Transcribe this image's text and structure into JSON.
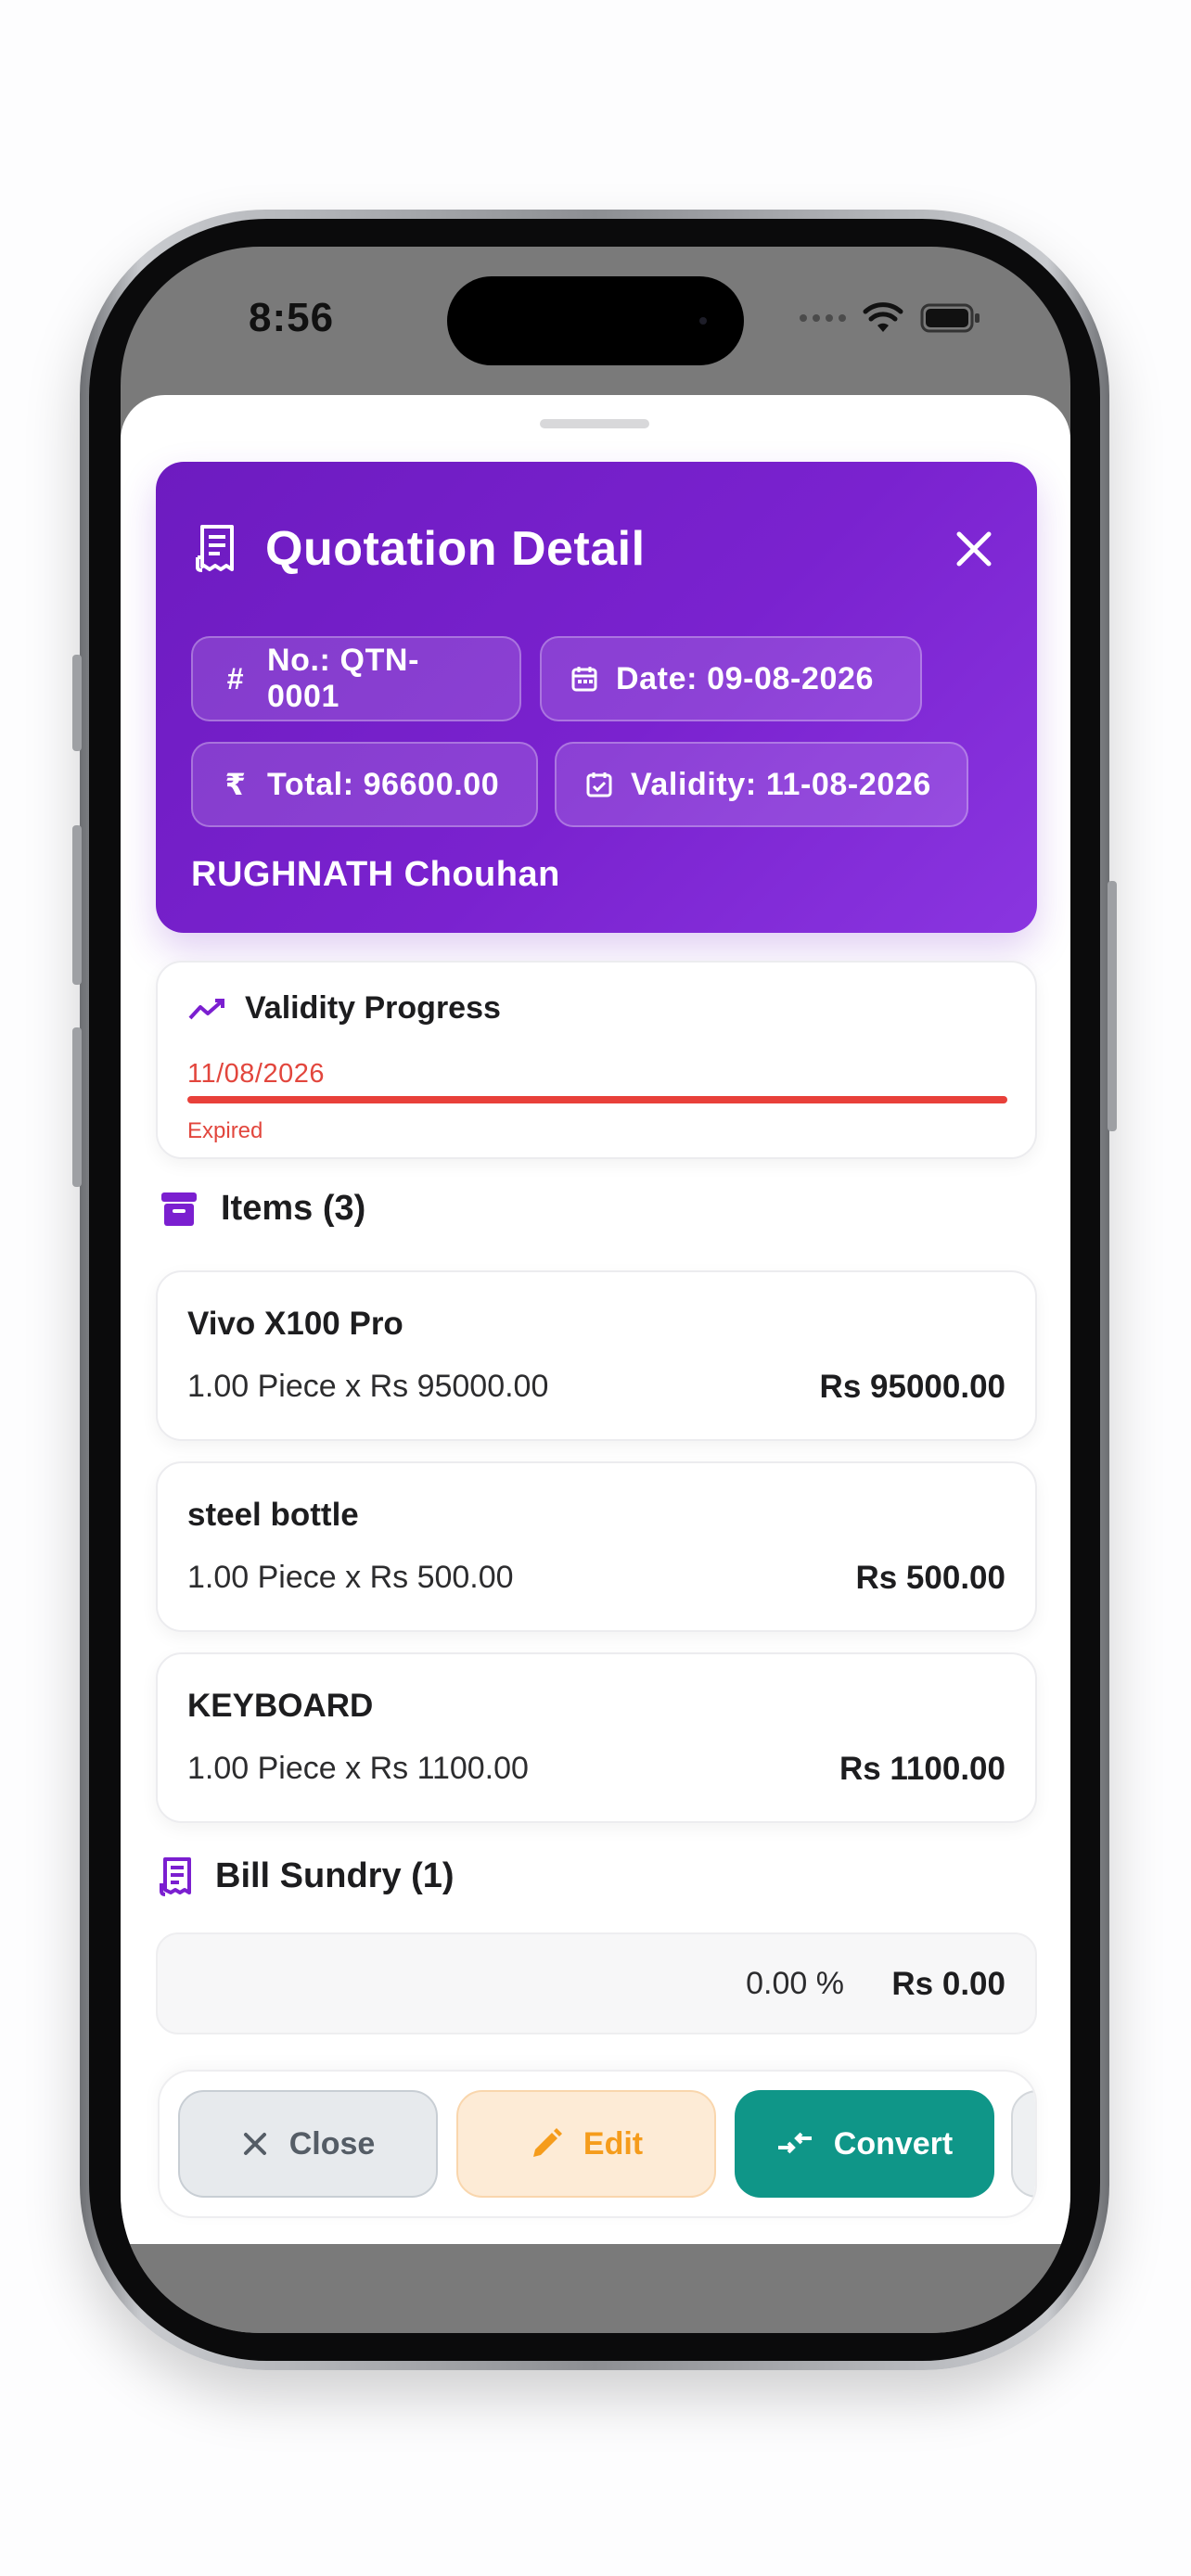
{
  "status_bar": {
    "time": "8:56"
  },
  "header": {
    "title": "Quotation Detail",
    "number_chip": "No.: QTN-0001",
    "date_chip": "Date: 09-08-2026",
    "total_chip": "Total: 96600.00",
    "validity_chip": "Validity: 11-08-2026",
    "customer": "RUGHNATH Chouhan",
    "hash_glyph": "#",
    "rupee_glyph": "₹"
  },
  "validity": {
    "title": "Validity Progress",
    "date": "11/08/2026",
    "status": "Expired",
    "progress": 1.0,
    "bar_color": "#e8403a"
  },
  "items": {
    "title": "Items (3)",
    "list": [
      {
        "name": "Vivo X100 Pro",
        "qty_line": "1.00 Piece x Rs 95000.00",
        "amount": "Rs 95000.00"
      },
      {
        "name": "steel bottle",
        "qty_line": "1.00 Piece x Rs 500.00",
        "amount": "Rs 500.00"
      },
      {
        "name": "KEYBOARD",
        "qty_line": "1.00 Piece x Rs 1100.00",
        "amount": "Rs 1100.00"
      }
    ]
  },
  "bill_sundry": {
    "title": "Bill Sundry (1)",
    "percent": "0.00 %",
    "amount": "Rs 0.00"
  },
  "actions": {
    "close_label": "Close",
    "edit_label": "Edit",
    "convert_label": "Convert"
  },
  "colors": {
    "header_gradient_start": "#6d1bc0",
    "header_gradient_end": "#8a35e0",
    "accent_purple": "#7b1fd0",
    "expired_red": "#e2463d",
    "convert_teal": "#0f9688",
    "edit_orange": "#f59c1c"
  },
  "icons": [
    "receipt-icon",
    "close-icon",
    "hash-icon",
    "calendar-icon",
    "rupee-icon",
    "calendar-check-icon",
    "trending-icon",
    "archive-icon",
    "edit-icon",
    "convert-icon",
    "wifi-icon",
    "battery-icon"
  ]
}
